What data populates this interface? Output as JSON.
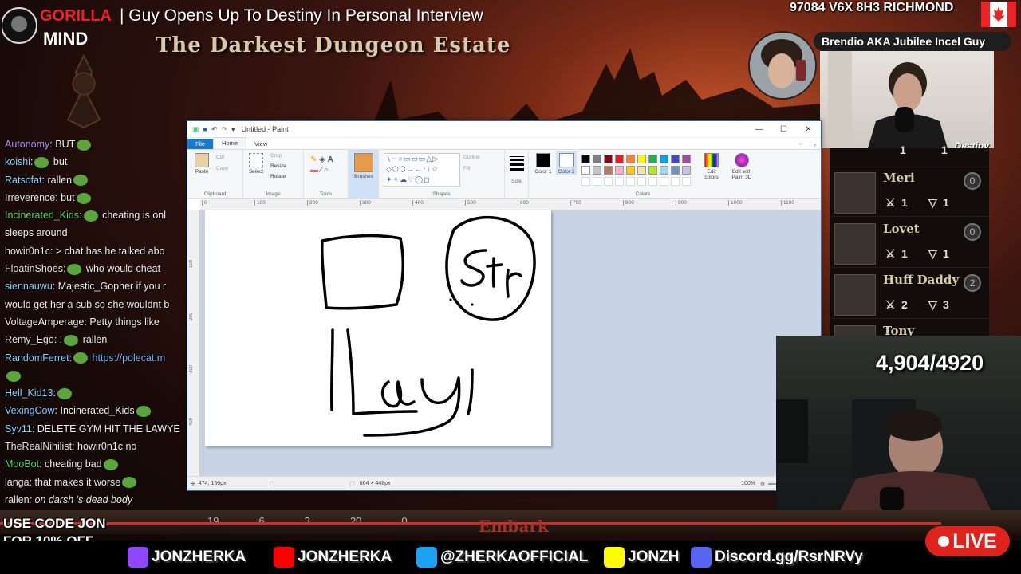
{
  "stream": {
    "brand_top": "GORILLA",
    "brand_bottom": "MIND",
    "title": "| Guy Opens Up To Destiny In Personal Interview",
    "game_title": "The Darkest Dungeon Estate",
    "address": "97084 V6X 8H3 RICHMOND",
    "guest_label": "Brendio AKA Jubilee Incel Guy",
    "destiny_tag": "Destiny",
    "counter": "4,904/4920",
    "promo": [
      "USE CODE JON",
      "FOR 10% OFF"
    ],
    "live_label": "LIVE",
    "embark_label": "Embark",
    "colors": {
      "accent_red": "#e0221c",
      "twitch": "#9146ff",
      "youtube": "#ff0000",
      "twitter": "#1da1f2",
      "snapchat": "#fffc00",
      "discord": "#5865f2"
    }
  },
  "socials": [
    {
      "icon": "twitch-icon",
      "label": "JONZHERKA"
    },
    {
      "icon": "youtube-icon",
      "label": "JONZHERKA"
    },
    {
      "icon": "twitter-icon",
      "label": "@ZHERKAOFFICIAL"
    },
    {
      "icon": "snapchat-icon",
      "label": "JONZH"
    },
    {
      "icon": "discord-icon",
      "label": "Discord.gg/RsrNRVy"
    }
  ],
  "chat": [
    {
      "user": "Autonomy",
      "color": "#b98bff",
      "msg": ": BUT",
      "emote": true
    },
    {
      "user": "koishi",
      "color": "#7fd0ff",
      "msg": ":",
      "emote": true,
      "after": " but"
    },
    {
      "user": "Ratsofat",
      "color": "#7fd0ff",
      "msg": ": rallen",
      "emote": true
    },
    {
      "user": "Irreverence",
      "color": "#e6e6e6",
      "msg": ": but",
      "emote": true
    },
    {
      "user": "Incinerated_Kids",
      "color": "#5fd35f",
      "msg": ":",
      "emote": true,
      "after": " cheating is onl"
    },
    {
      "user": "",
      "color": "#eee",
      "msg": "sleeps around"
    },
    {
      "user": "howir0n1c",
      "color": "#e6e6e6",
      "msg": ": > chat has he talked abo"
    },
    {
      "user": "FloatinShoes",
      "color": "#e6e6e6",
      "msg": ":",
      "emote": true,
      "after": " who would cheat"
    },
    {
      "user": "siennauwu",
      "color": "#7fd0ff",
      "msg": ": Majestic_Gopher if you r"
    },
    {
      "user": "",
      "color": "#eee",
      "msg": "would get her a sub so she wouldnt b"
    },
    {
      "user": "VoltageAmperage",
      "color": "#e6e6e6",
      "msg": ": Petty things like"
    },
    {
      "user": "Remy_Ego",
      "color": "#e6e6e6",
      "msg": ": !",
      "emote": true,
      "after": " rallen"
    },
    {
      "user": "RandomFerret",
      "color": "#7fd0ff",
      "msg": ":",
      "emote": true,
      "after": " https://polecat.m",
      "link": true
    },
    {
      "user": "",
      "color": "#eee",
      "msg": "",
      "emote": true
    },
    {
      "user": "Hell_Kid13",
      "color": "#7fd0ff",
      "msg": ":",
      "emote": true
    },
    {
      "user": "VexingCow",
      "color": "#7fd0ff",
      "msg": ": Incinerated_Kids",
      "emote": true
    },
    {
      "user": "Syv11",
      "color": "#7fd0ff",
      "msg": ": DELETE GYM HIT THE LAWYE"
    },
    {
      "user": "TheRealNihilist",
      "color": "#e6e6e6",
      "msg": ": howir0n1c no"
    },
    {
      "user": "MooBot",
      "color": "#5fd35f",
      "msg": ": cheating bad",
      "emote": true
    },
    {
      "user": "langa",
      "color": "#e6e6e6",
      "msg": ": that makes it worse",
      "emote": true
    },
    {
      "user": "rallen",
      "color": "#e6e6e6",
      "msg": ": on darsh 's dead body",
      "italic": true
    }
  ],
  "paint": {
    "window_title": "Untitled - Paint",
    "tabs": [
      "File",
      "Home",
      "View"
    ],
    "groups": [
      "Clipboard",
      "Image",
      "Tools",
      "Brushes",
      "Shapes",
      "Size",
      "Colors"
    ],
    "clipboard": {
      "paste": "Paste",
      "cut": "Cut",
      "copy": "Copy"
    },
    "image": {
      "select": "Select",
      "crop": "Crop",
      "resize": "Resize",
      "rotate": "Rotate"
    },
    "shapes": {
      "outline": "Outline",
      "fill": "Fill"
    },
    "colors_labels": {
      "color1": "Color 1",
      "color2": "Color 2",
      "edit": "Edit colors",
      "paint3d": "Edit with Paint 3D"
    },
    "ruler_ticks": [
      "0",
      "100",
      "200",
      "300",
      "400",
      "500",
      "600",
      "700",
      "800",
      "900",
      "1000",
      "1100"
    ],
    "ruler_v_ticks": [
      "100",
      "200",
      "300",
      "400"
    ],
    "status": {
      "cursor": "474, 166px",
      "size": "664 × 448px",
      "zoom": "100%"
    },
    "palette": [
      "#000000",
      "#7f7f7f",
      "#880015",
      "#ed1c24",
      "#ff7f27",
      "#fff200",
      "#22b14c",
      "#00a2e8",
      "#3f48cc",
      "#a349a4",
      "#ffffff",
      "#c3c3c3",
      "#b97a57",
      "#ffaec9",
      "#ffc90e",
      "#efe4b0",
      "#b5e61d",
      "#99d9ea",
      "#7092be",
      "#c8bfe7"
    ]
  },
  "party": [
    {
      "name": "Meri",
      "a": "1",
      "b": "1",
      "lvl": "0"
    },
    {
      "name": "Lovet",
      "a": "1",
      "b": "1",
      "lvl": "0"
    },
    {
      "name": "Huff Daddy",
      "a": "2",
      "b": "3",
      "lvl": "2"
    },
    {
      "name": "Tony",
      "a": "",
      "b": "",
      "lvl": ""
    }
  ],
  "party_top": {
    "a": "1",
    "b": "1"
  },
  "bottom_stats": [
    "19",
    "6",
    "3",
    "20",
    "0"
  ]
}
